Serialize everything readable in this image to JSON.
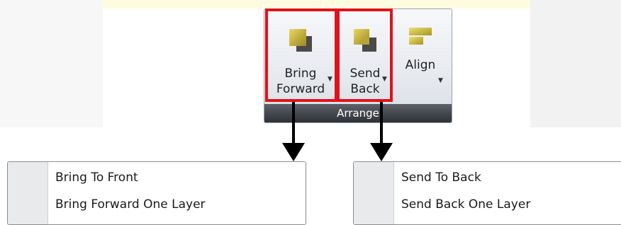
{
  "ribbon": {
    "group_label": "Arrange",
    "buttons": [
      {
        "line1": "Bring",
        "line2": "Forward",
        "icon": "bring-forward-icon"
      },
      {
        "line1": "Send",
        "line2": "Back",
        "icon": "send-back-icon"
      },
      {
        "line1": "Align",
        "line2": "",
        "icon": "align-icon"
      }
    ]
  },
  "bring_forward_menu": {
    "items": [
      "Bring To Front",
      "Bring Forward One Layer"
    ]
  },
  "send_back_menu": {
    "items": [
      "Send To Back",
      "Send Back One Layer"
    ]
  },
  "colors": {
    "highlight": "#e0121b",
    "icon_gold": "#c8b22f",
    "icon_dark": "#555555"
  }
}
